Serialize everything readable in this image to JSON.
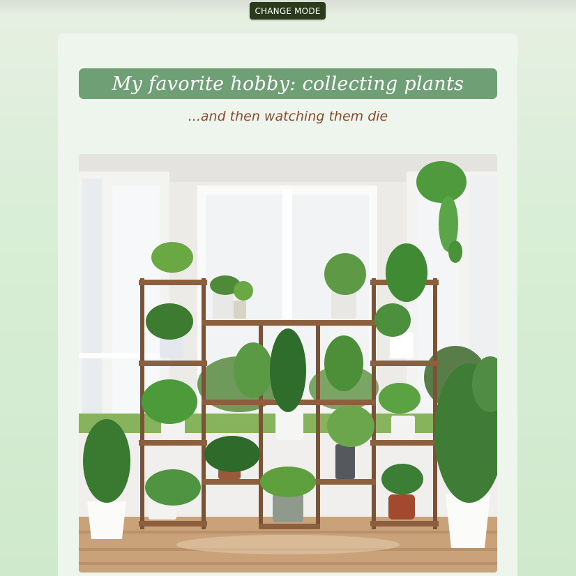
{
  "toolbar": {
    "change_mode_label": "CHANGE MODE"
  },
  "card": {
    "title": "My favorite hobby: collecting plants",
    "subtitle": "...and then watching them die"
  },
  "colors": {
    "page_background": "#d8eed6",
    "card_background": "#eef5ec",
    "title_bar": "#6f9f74",
    "subtitle_text": "#8a4a2e",
    "button_background": "#2c3a1c"
  }
}
